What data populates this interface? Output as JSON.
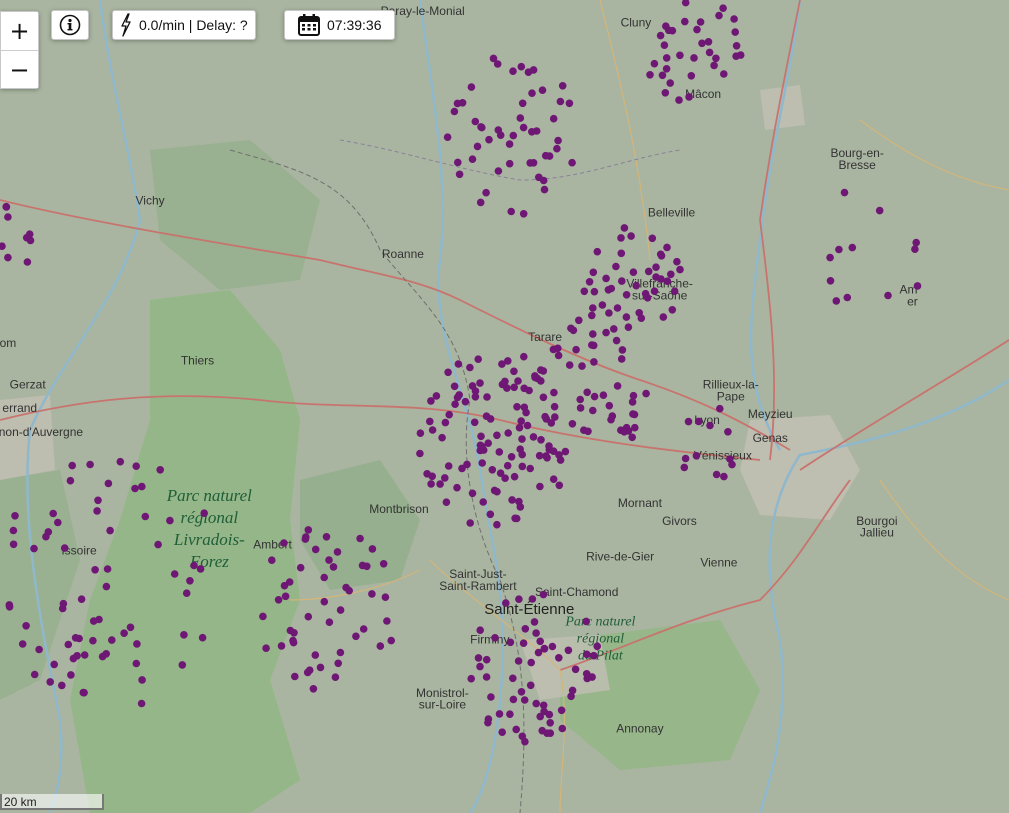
{
  "map": {
    "colors": {
      "land": "#a9b5a0",
      "forest": "#8fae87",
      "park": "#92b684",
      "urban": "#c2bfb4",
      "water": "#8fb8cc",
      "main_road": "#c8746e",
      "secondary_road": "#d4b57a",
      "marker": "#6e1774"
    },
    "places": [
      {
        "name": "Paray-le-Monial",
        "lon": 4.12,
        "lat": 46.45
      },
      {
        "name": "Cluny",
        "lon": 4.66,
        "lat": 46.43
      },
      {
        "name": "Mâcon",
        "lon": 4.83,
        "lat": 46.31
      },
      {
        "name": "Bourg-en-",
        "lon": 5.22,
        "lat": 46.21
      },
      {
        "name": "Bresse",
        "lon": 5.22,
        "lat": 46.19
      },
      {
        "name": "Vichy",
        "lon": 3.43,
        "lat": 46.13
      },
      {
        "name": "Belleville",
        "lon": 4.75,
        "lat": 46.11
      },
      {
        "name": "Roanne",
        "lon": 4.07,
        "lat": 46.04
      },
      {
        "name": "Villefranche-",
        "lon": 4.72,
        "lat": 45.99
      },
      {
        "name": "sur-Saône",
        "lon": 4.72,
        "lat": 45.97
      },
      {
        "name": "Tarare",
        "lon": 4.43,
        "lat": 45.9
      },
      {
        "name": "Thiers",
        "lon": 3.55,
        "lat": 45.86
      },
      {
        "name": "Rillieux-la-",
        "lon": 4.9,
        "lat": 45.82
      },
      {
        "name": "Pape",
        "lon": 4.9,
        "lat": 45.8
      },
      {
        "name": "Lyon",
        "lon": 4.84,
        "lat": 45.76
      },
      {
        "name": "Meyzieu",
        "lon": 5.0,
        "lat": 45.77
      },
      {
        "name": "Genas",
        "lon": 5.0,
        "lat": 45.73
      },
      {
        "name": "Vénissieux",
        "lon": 4.88,
        "lat": 45.7
      },
      {
        "name": "errand",
        "lon": 3.1,
        "lat": 45.78
      },
      {
        "name": "urnon-d'Auvergne",
        "lon": 3.14,
        "lat": 45.74
      },
      {
        "name": "Gerzat",
        "lon": 3.12,
        "lat": 45.82
      },
      {
        "name": "om",
        "lon": 3.07,
        "lat": 45.89
      },
      {
        "name": "Montbrison",
        "lon": 4.06,
        "lat": 45.61
      },
      {
        "name": "Mornant",
        "lon": 4.67,
        "lat": 45.62
      },
      {
        "name": "Givors",
        "lon": 4.77,
        "lat": 45.59
      },
      {
        "name": "Ambert",
        "lon": 3.74,
        "lat": 45.55
      },
      {
        "name": "Issoire",
        "lon": 3.25,
        "lat": 45.54
      },
      {
        "name": "Saint-Just-",
        "lon": 4.26,
        "lat": 45.5
      },
      {
        "name": "Saint-Rambert",
        "lon": 4.26,
        "lat": 45.48
      },
      {
        "name": "Rive-de-Gier",
        "lon": 4.62,
        "lat": 45.53
      },
      {
        "name": "Vienne",
        "lon": 4.87,
        "lat": 45.52
      },
      {
        "name": "Saint-Chamond",
        "lon": 4.51,
        "lat": 45.47
      },
      {
        "name": "Firminy",
        "lon": 4.29,
        "lat": 45.39
      },
      {
        "name": "Monistrol-",
        "lon": 4.17,
        "lat": 45.3
      },
      {
        "name": "sur-Loire",
        "lon": 4.17,
        "lat": 45.28
      },
      {
        "name": "Annonay",
        "lon": 4.67,
        "lat": 45.24
      },
      {
        "name": "Bourgoi",
        "lon": 5.27,
        "lat": 45.59
      },
      {
        "name": "Jallieu",
        "lon": 5.27,
        "lat": 45.57
      },
      {
        "name": "Am",
        "lon": 5.35,
        "lat": 45.98
      },
      {
        "name": "er",
        "lon": 5.36,
        "lat": 45.96
      }
    ],
    "big_places": [
      {
        "name": "Saint-Étienne",
        "lon": 4.39,
        "lat": 45.44
      }
    ],
    "parks": [
      {
        "lines": [
          "Parc naturel",
          "régional",
          "Livradois-",
          "Forez"
        ],
        "lon": 3.58,
        "lat": 45.63
      },
      {
        "lines": [
          "Parc naturel",
          "régional",
          "du Pilat"
        ],
        "lon": 4.57,
        "lat": 45.42
      }
    ],
    "strike_clusters": [
      {
        "lon": 3.33,
        "lat": 45.5,
        "count": 70,
        "spread": 0.22
      },
      {
        "lon": 3.88,
        "lat": 45.45,
        "count": 50,
        "spread": 0.14
      },
      {
        "lon": 4.4,
        "lat": 45.35,
        "count": 60,
        "spread": 0.13
      },
      {
        "lon": 4.3,
        "lat": 45.73,
        "count": 95,
        "spread": 0.15
      },
      {
        "lon": 4.52,
        "lat": 45.82,
        "count": 60,
        "spread": 0.13
      },
      {
        "lon": 4.65,
        "lat": 46.0,
        "count": 45,
        "spread": 0.1
      },
      {
        "lon": 4.35,
        "lat": 46.25,
        "count": 50,
        "spread": 0.14
      },
      {
        "lon": 4.8,
        "lat": 46.4,
        "count": 35,
        "spread": 0.1
      },
      {
        "lon": 3.04,
        "lat": 46.05,
        "count": 20,
        "spread": 0.08
      },
      {
        "lon": 5.25,
        "lat": 46.05,
        "count": 12,
        "spread": 0.12
      },
      {
        "lon": 4.85,
        "lat": 45.72,
        "count": 12,
        "spread": 0.07
      }
    ]
  },
  "controls": {
    "zoom_in": "+",
    "zoom_out": "−",
    "rate_delay": "0.0/min | Delay: ?",
    "time": "07:39:36"
  },
  "scale": {
    "label": "20 km"
  }
}
